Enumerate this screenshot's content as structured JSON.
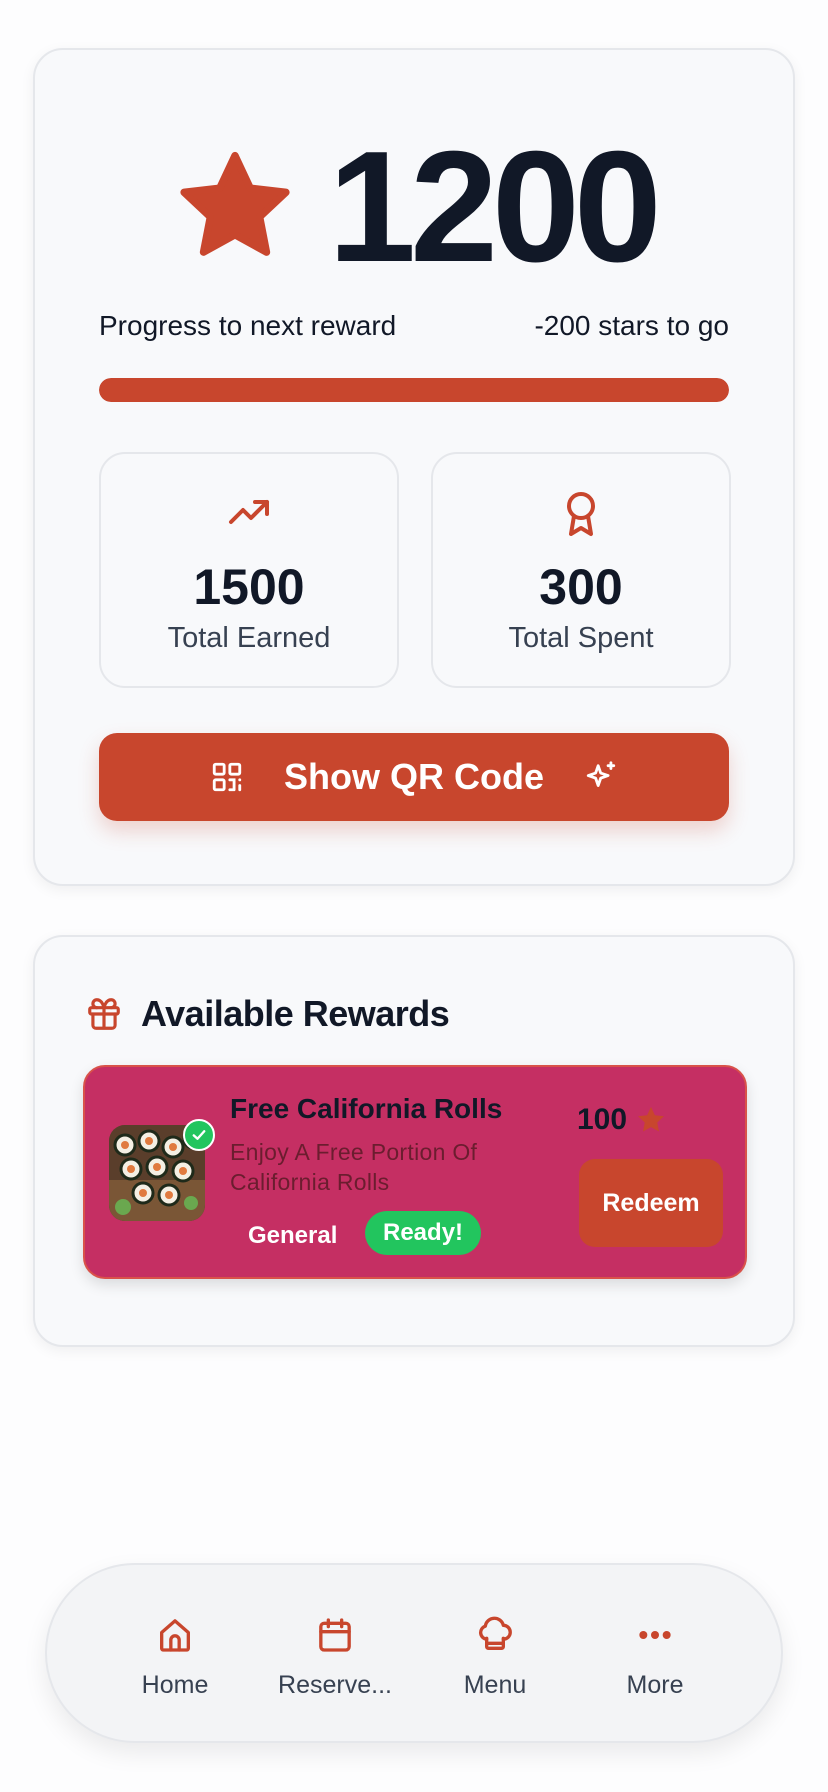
{
  "points": {
    "balance": "1200",
    "progress_label": "Progress to next reward",
    "progress_remaining": "-200 stars to go",
    "progress_fraction": 1.0
  },
  "stats": {
    "earned": {
      "value": "1500",
      "label": "Total Earned",
      "icon": "trending-up-icon"
    },
    "spent": {
      "value": "300",
      "label": "Total Spent",
      "icon": "award-icon"
    }
  },
  "qr_button": {
    "label": "Show QR Code"
  },
  "rewards": {
    "title": "Available Rewards",
    "items": [
      {
        "name": "Free California Rolls",
        "description": "Enjoy A Free Portion Of California Rolls",
        "category": "General",
        "status": "Ready!",
        "cost": "100",
        "action": "Redeem"
      }
    ]
  },
  "nav": {
    "items": [
      {
        "label": "Home",
        "icon": "home-icon"
      },
      {
        "label": "Reserve...",
        "icon": "calendar-icon"
      },
      {
        "label": "Menu",
        "icon": "chef-hat-icon"
      },
      {
        "label": "More",
        "icon": "more-dots-icon"
      }
    ]
  },
  "colors": {
    "accent": "#c8462d",
    "reward_card": "#c52f63",
    "ready": "#22c55e",
    "text": "#111827"
  }
}
